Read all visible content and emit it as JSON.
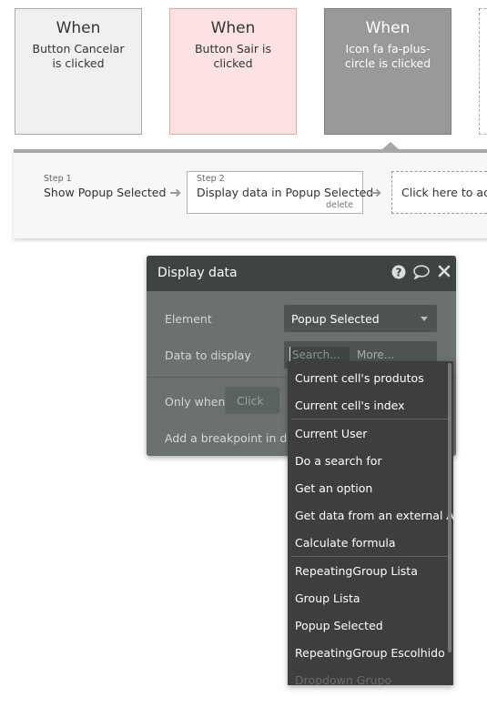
{
  "events": [
    {
      "when": "When",
      "description": "Button Cancelar is clicked"
    },
    {
      "when": "When",
      "description": "Button Sair is clicked"
    },
    {
      "when": "When",
      "description": "Icon fa fa-plus-circle is clicked"
    }
  ],
  "steps": [
    {
      "number": "Step 1",
      "name": "Show Popup Selected"
    },
    {
      "number": "Step 2",
      "name": "Display data in Popup Selected",
      "delete_label": "delete"
    }
  ],
  "add_step_label": "Click here to add",
  "editor": {
    "title": "Display data",
    "element_label": "Element",
    "element_value": "Popup Selected",
    "data_label": "Data to display",
    "search_placeholder": "Search...",
    "more_label": "More...",
    "only_when_label": "Only when",
    "only_when_placeholder": "Click",
    "breakpoint_label": "Add a breakpoint in deb"
  },
  "dropdown": {
    "items": [
      "Current cell's produtos",
      "Current cell's index",
      "Current User",
      "Do a search for",
      "Get an option",
      "Get data from an external API",
      "Calculate formula",
      "RepeatingGroup Lista",
      "Group Lista",
      "Popup Selected",
      "RepeatingGroup Escolhido",
      "Dropdown Grupo"
    ]
  },
  "icons": {
    "help": "question-circle-icon",
    "comment": "comment-icon",
    "close": "close-icon",
    "arrow": "arrow-right-icon"
  }
}
